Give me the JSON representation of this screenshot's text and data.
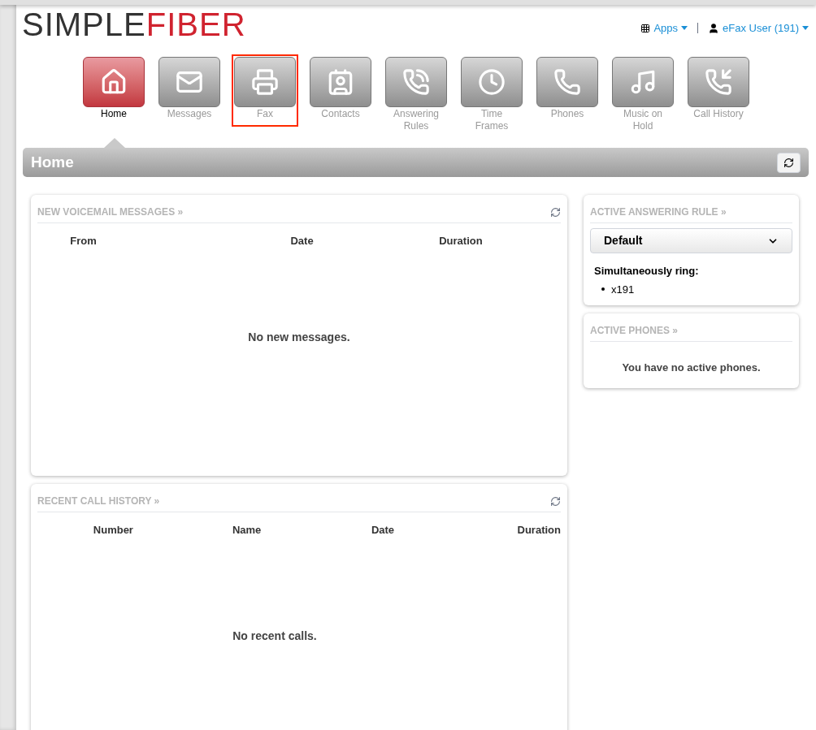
{
  "logo": {
    "dark": "SIMPLE",
    "red": "FIBER"
  },
  "top_links": [
    {
      "label": "Apps",
      "kind": "apps"
    },
    {
      "label": "eFax User (191)",
      "kind": "user"
    }
  ],
  "nav": [
    {
      "label": "Home",
      "selected": true,
      "highlighted": false
    },
    {
      "label": "Messages",
      "selected": false,
      "highlighted": false
    },
    {
      "label": "Fax",
      "selected": false,
      "highlighted": true
    },
    {
      "label": "Contacts",
      "selected": false,
      "highlighted": false
    },
    {
      "label": "Answering Rules",
      "selected": false,
      "highlighted": false
    },
    {
      "label": "Time Frames",
      "selected": false,
      "highlighted": false
    },
    {
      "label": "Phones",
      "selected": false,
      "highlighted": false
    },
    {
      "label": "Music on Hold",
      "selected": false,
      "highlighted": false
    },
    {
      "label": "Call History",
      "selected": false,
      "highlighted": false
    }
  ],
  "page_title": "Home",
  "voicemail": {
    "title": "NEW VOICEMAIL MESSAGES »",
    "columns": [
      "From",
      "Date",
      "Duration"
    ],
    "empty": "No new messages."
  },
  "call_history": {
    "title": "RECENT CALL HISTORY »",
    "columns": [
      "Number",
      "Name",
      "Date",
      "Duration"
    ],
    "empty": "No recent calls."
  },
  "answering_rule": {
    "title": "ACTIVE ANSWERING RULE »",
    "value": "Default",
    "ring_label": "Simultaneously ring:",
    "ring_items": [
      "x191"
    ]
  },
  "active_phones": {
    "title": "ACTIVE PHONES »",
    "empty": "You have no active phones."
  }
}
